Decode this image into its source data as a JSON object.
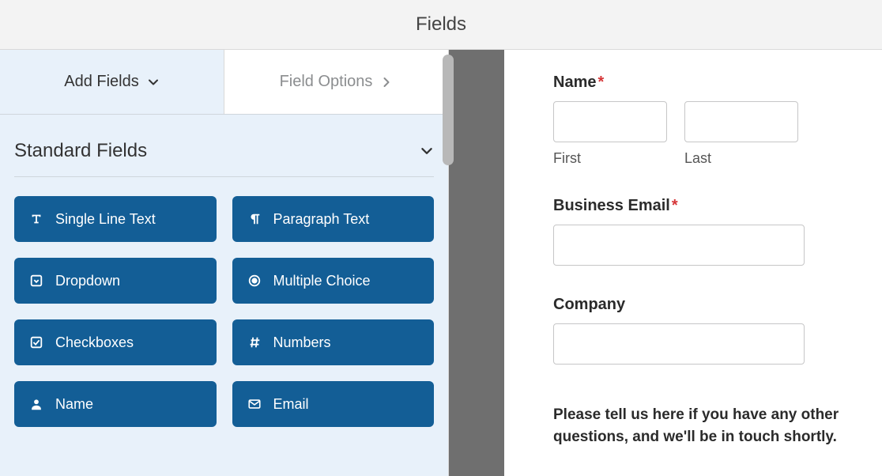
{
  "header": {
    "title": "Fields"
  },
  "tabs": {
    "add": "Add Fields",
    "options": "Field Options"
  },
  "section": {
    "title": "Standard Fields"
  },
  "fields": {
    "single_line": "Single Line Text",
    "paragraph": "Paragraph Text",
    "dropdown": "Dropdown",
    "multiple_choice": "Multiple Choice",
    "checkboxes": "Checkboxes",
    "numbers": "Numbers",
    "name": "Name",
    "email": "Email"
  },
  "preview": {
    "name_label": "Name",
    "first_sub": "First",
    "last_sub": "Last",
    "email_label": "Business Email",
    "company_label": "Company",
    "footer": "Please tell us here if you have any other questions, and we'll be in touch shortly."
  }
}
